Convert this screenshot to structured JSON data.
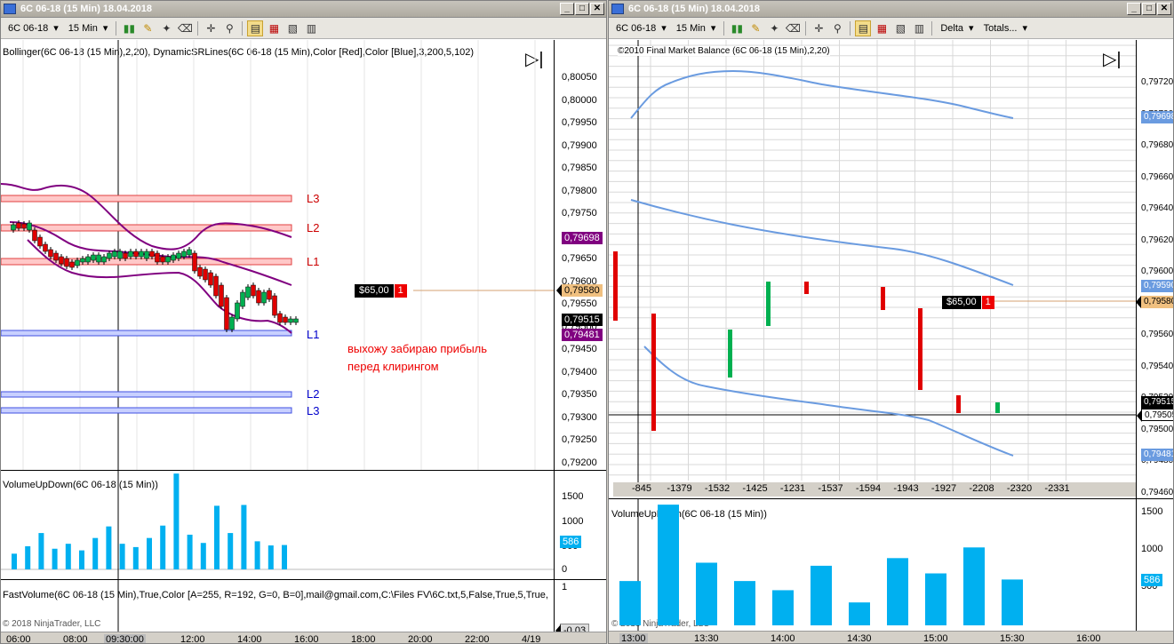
{
  "left_window": {
    "title": "6C 06-18 (15 Min)  18.04.2018",
    "instrument": "6C 06-18",
    "interval": "15 Min",
    "indicator_label": "Bollinger(6C 06-18 (15 Min),2,20), DynamicSRLines(6C 06-18 (15 Min),Color [Red],Color [Blue],3,200,5,102)",
    "price_ticks": [
      "0,80050",
      "0,80000",
      "0,79950",
      "0,79900",
      "0,79850",
      "0,79800",
      "0,79750",
      "0,79700",
      "0,79650",
      "0,79600",
      "0,79550",
      "0,79500",
      "0,79450",
      "0,79400",
      "0,79350",
      "0,79300",
      "0,79250",
      "0,79200"
    ],
    "tag_upper": "0,79698",
    "tag_current": "0,79580",
    "tag_last": "0,79515",
    "tag_lower": "0,79481",
    "sr_labels": {
      "r3": "L3",
      "r2": "L2",
      "r1": "L1",
      "s1": "L1",
      "s2": "L2",
      "s3": "L3"
    },
    "order_qty": "$65,00",
    "order_num": "1",
    "annotation_line1": "выхожу забираю прибыль",
    "annotation_line2": "перед клирингом",
    "volume_label": "VolumeUpDown(6C 06-18 (15 Min))",
    "volume_ticks": [
      "1500",
      "1000",
      "500",
      "0"
    ],
    "volume_tag": "586",
    "fastvol_label": "FastVolume(6C 06-18 (15 Min),True,Color [A=255, R=192, G=0, B=0],mail@gmail.com,C:\\Files FV\\6C.txt,5,False,True,5,True,",
    "fastvol_ticks": [
      "1"
    ],
    "fastvol_tag": "-0,03",
    "copyright": "© 2018 NinjaTrader, LLC",
    "time_ticks": [
      "06:00",
      "08:00",
      "09:30:00",
      "12:00",
      "14:00",
      "16:00",
      "18:00",
      "20:00",
      "22:00",
      "4/19"
    ],
    "f_button": "F"
  },
  "right_window": {
    "title": "6C 06-18 (15 Min)  18.04.2018",
    "instrument": "6C 06-18",
    "interval": "15 Min",
    "delta_label": "Delta",
    "totals_label": "Totals...",
    "indicator_label": "©2010 Final Market Balance  (6C 06-18 (15 Min),2,20)",
    "price_ticks": [
      "0,79720",
      "0,79700",
      "0,79680",
      "0,79660",
      "0,79640",
      "0,79620",
      "0,79600",
      "0,79580",
      "0,79560",
      "0,79540",
      "0,79520",
      "0,79500",
      "0,79480",
      "0,79460"
    ],
    "tag_upper": "0,79698",
    "tag_590": "0,79590",
    "tag_current": "0,79580",
    "tag_last": "0,79515",
    "tag_505": "0,79505",
    "tag_lower": "0,79481",
    "order_qty": "$65,00",
    "order_num": "1",
    "totals": [
      "-845",
      "-1379",
      "-1532",
      "-1425",
      "-1231",
      "-1537",
      "-1594",
      "-1943",
      "-1927",
      "-2208",
      "-2320",
      "-2331"
    ],
    "volume_label": "VolumeUpDown(6C 06-18 (15 Min))",
    "volume_ticks": [
      "1500",
      "1000",
      "500"
    ],
    "volume_tag": "586",
    "copyright": "© 2018 NinjaTrader, LLC",
    "time_ticks": [
      "13:00",
      "13:30",
      "14:00",
      "14:30",
      "15:00",
      "15:30",
      "16:00"
    ],
    "f_button": "F"
  },
  "chart_data": [
    {
      "type": "bar",
      "title": "VolumeUpDown(6C 06-18 (15 Min))",
      "series": [
        {
          "name": "Volume",
          "values": [
            380,
            560,
            880,
            500,
            620,
            460,
            760,
            1040,
            620,
            540,
            760,
            1060,
            2320,
            840,
            640,
            1540,
            880,
            1560,
            680,
            580,
            590
          ]
        }
      ]
    },
    {
      "type": "bar",
      "title": "VolumeUpDown(6C 06-18 (15 Min))",
      "categories": [
        "13:00",
        "13:15",
        "13:30",
        "13:45",
        "14:00",
        "14:15",
        "14:30",
        "14:45",
        "15:00",
        "15:15",
        "15:30"
      ],
      "series": [
        {
          "name": "Volume",
          "values": [
            580,
            1580,
            820,
            580,
            460,
            780,
            300,
            880,
            680,
            1020,
            600
          ]
        }
      ]
    }
  ],
  "colors": {
    "up": "#00b050",
    "down": "#e00000",
    "bollinger": "#800080",
    "sr_red": "#ff6060",
    "sr_blue": "#4060ff",
    "volume": "#00b0f0",
    "fmb_line": "#6a9be0"
  }
}
